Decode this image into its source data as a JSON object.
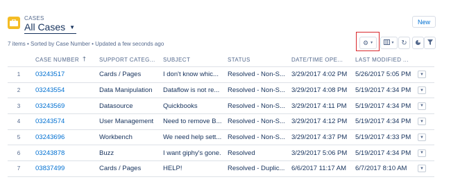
{
  "header": {
    "object_label": "CASES",
    "view_title": "All Cases",
    "new_button": "New"
  },
  "summary": "7 items • Sorted by Case Number • Updated a few seconds ago",
  "icons": {
    "object": "briefcase-icon",
    "view_dropdown": "chevron-down-icon",
    "settings": "gear-icon",
    "columns": "table-columns-icon",
    "refresh": "refresh-icon",
    "charts": "pie-chart-icon",
    "filter": "filter-icon",
    "row_menu": "caret-down-icon",
    "sort": "arrow-up-icon"
  },
  "colors": {
    "accent": "#0070d2",
    "object_icon": "#f4bc25",
    "highlight": "#d9262b"
  },
  "columns": [
    "CASE NUMBER",
    "SUPPORT CATEG...",
    "SUBJECT",
    "STATUS",
    "DATE/TIME OPE...",
    "LAST MODIFIED ..."
  ],
  "rows": [
    {
      "num": "1",
      "case": "03243517",
      "category": "Cards / Pages",
      "subject": "I don't know whic...",
      "status": "Resolved - Non-S...",
      "opened": "3/29/2017 4:02 PM",
      "modified": "5/26/2017 5:05 PM"
    },
    {
      "num": "2",
      "case": "03243554",
      "category": "Data Manipulation",
      "subject": "Dataflow is not re...",
      "status": "Resolved - Non-S...",
      "opened": "3/29/2017 4:08 PM",
      "modified": "5/19/2017 4:34 PM"
    },
    {
      "num": "3",
      "case": "03243569",
      "category": "Datasource",
      "subject": "Quickbooks",
      "status": "Resolved - Non-S...",
      "opened": "3/29/2017 4:11 PM",
      "modified": "5/19/2017 4:34 PM"
    },
    {
      "num": "4",
      "case": "03243574",
      "category": "User Management",
      "subject": "Need to remove B...",
      "status": "Resolved - Non-S...",
      "opened": "3/29/2017 4:12 PM",
      "modified": "5/19/2017 4:34 PM"
    },
    {
      "num": "5",
      "case": "03243696",
      "category": "Workbench",
      "subject": "We need help sett...",
      "status": "Resolved - Non-S...",
      "opened": "3/29/2017 4:37 PM",
      "modified": "5/19/2017 4:33 PM"
    },
    {
      "num": "6",
      "case": "03243878",
      "category": "Buzz",
      "subject": "I want giphy's gone.",
      "status": "Resolved",
      "opened": "3/29/2017 5:06 PM",
      "modified": "5/19/2017 4:34 PM"
    },
    {
      "num": "7",
      "case": "03837499",
      "category": "Cards / Pages",
      "subject": "HELP!",
      "status": "Resolved - Duplic...",
      "opened": "6/6/2017 11:17 AM",
      "modified": "6/7/2017 8:10 AM"
    }
  ]
}
